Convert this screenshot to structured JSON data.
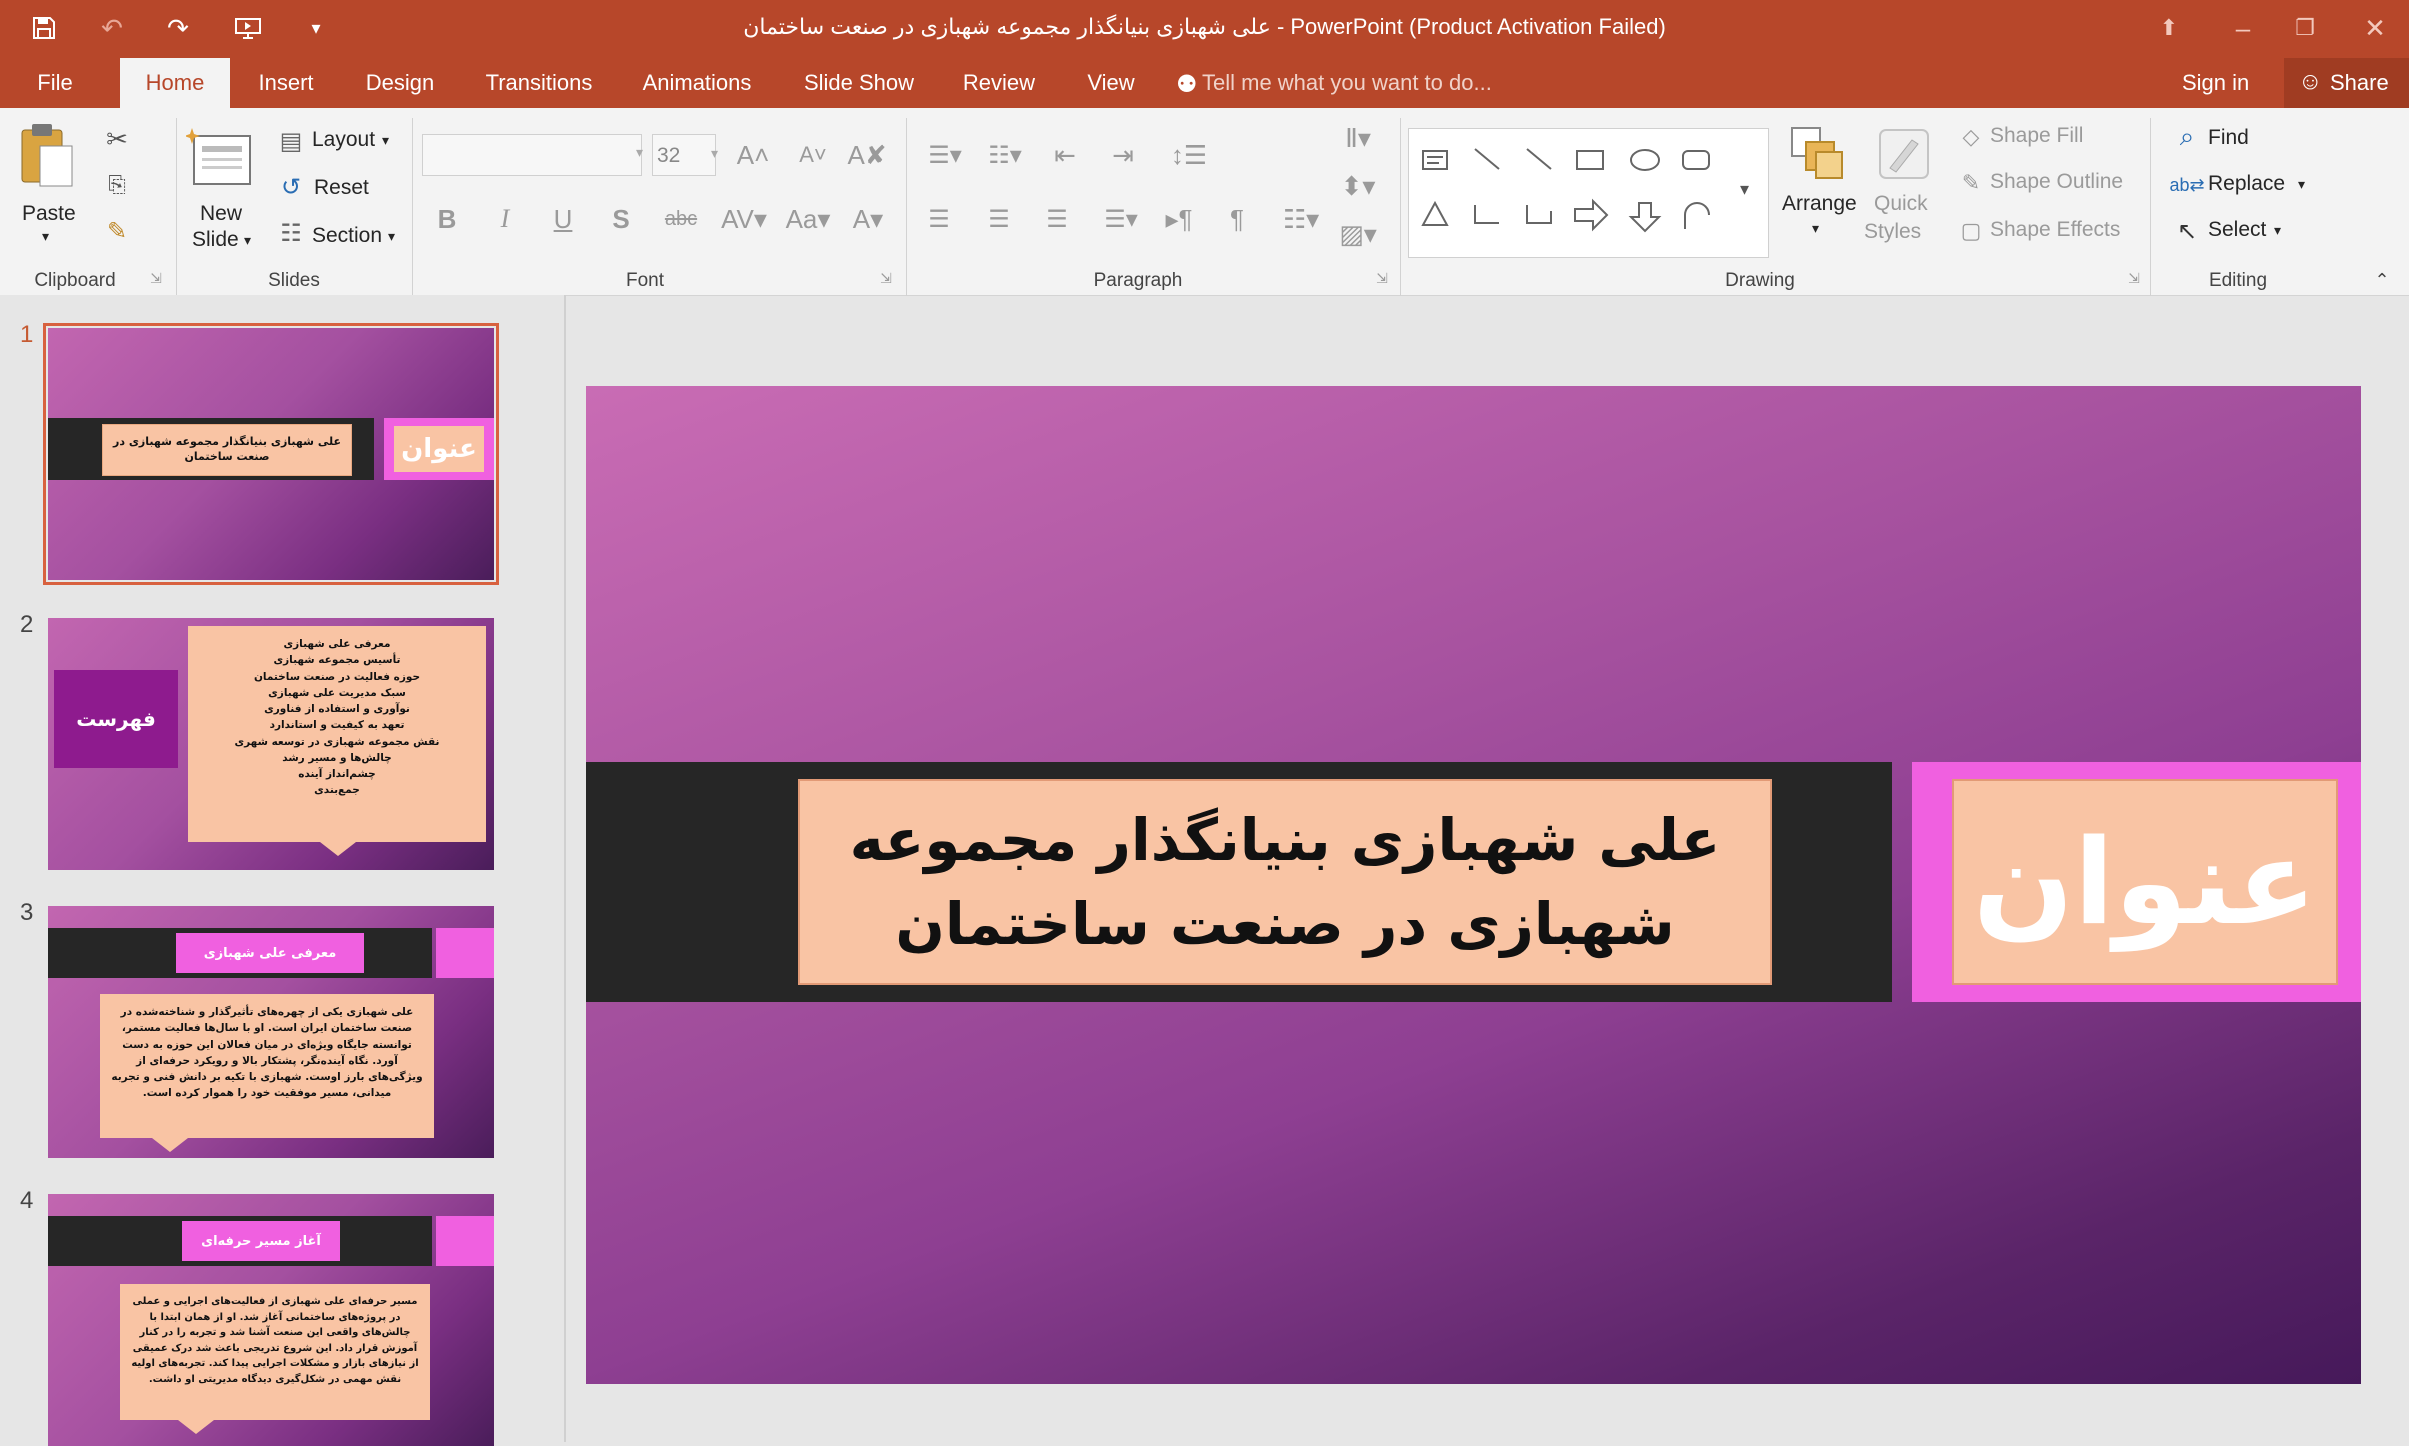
{
  "window": {
    "title": "علی شهبازی بنیانگذار مجموعه شهبازی در صنعت ساختمان - PowerPoint (Product Activation Failed)"
  },
  "tabs": [
    {
      "label": "File"
    },
    {
      "label": "Home"
    },
    {
      "label": "Insert"
    },
    {
      "label": "Design"
    },
    {
      "label": "Transitions"
    },
    {
      "label": "Animations"
    },
    {
      "label": "Slide Show"
    },
    {
      "label": "Review"
    },
    {
      "label": "View"
    }
  ],
  "tell_me": {
    "placeholder": "Tell me what you want to do..."
  },
  "account": {
    "sign_in": "Sign in",
    "share": "Share"
  },
  "ribbon": {
    "clipboard": {
      "label": "Clipboard",
      "paste": "Paste"
    },
    "slides": {
      "label": "Slides",
      "new_slide_1": "New",
      "new_slide_2": "Slide",
      "layout": "Layout",
      "reset": "Reset",
      "section": "Section"
    },
    "font": {
      "label": "Font",
      "size": "32",
      "bold": "B",
      "italic": "I",
      "underline": "U",
      "shadow": "S",
      "strike": "abc",
      "case": "Aa"
    },
    "paragraph": {
      "label": "Paragraph"
    },
    "drawing": {
      "label": "Drawing",
      "arrange": "Arrange",
      "quick_styles_1": "Quick",
      "quick_styles_2": "Styles",
      "shape_fill": "Shape Fill",
      "shape_outline": "Shape Outline",
      "shape_effects": "Shape Effects"
    },
    "editing": {
      "label": "Editing",
      "find": "Find",
      "replace": "Replace",
      "select": "Select"
    }
  },
  "thumbnails": [
    {
      "number": "1",
      "title": "علی شهبازی بنیانگذار مجموعه شهبازی در صنعت ساختمان",
      "tag": "عنوان"
    },
    {
      "number": "2",
      "tag": "فهرست",
      "items": [
        "معرفی علی شهبازی",
        "تأسیس مجموعه شهبازی",
        "حوزه فعالیت در صنعت ساختمان",
        "سبک مدیریت علی شهبازی",
        "نوآوری و استفاده از فناوری",
        "تعهد به کیفیت و استاندارد",
        "نقش مجموعه شهبازی در توسعه شهری",
        "چالش‌ها و مسیر رشد",
        "چشم‌انداز آینده",
        "جمع‌بندی"
      ]
    },
    {
      "number": "3",
      "title": "معرفی علی شهبازی",
      "body": "علی شهبازی یکی از چهره‌های تأثیرگذار و شناخته‌شده در صنعت ساختمان ایران است. او با سال‌ها فعالیت مستمر، توانسته جایگاه ویژه‌ای در میان فعالان این حوزه به دست آورد. نگاه آینده‌نگر، پشتکار بالا و رویکرد حرفه‌ای از ویژگی‌های بارز اوست. شهبازی با تکیه بر دانش فنی و تجربه میدانی، مسیر موفقیت خود را هموار کرده است."
    },
    {
      "number": "4",
      "title": "آغاز مسیر حرفه‌ای",
      "body": "مسیر حرفه‌ای علی شهبازی از فعالیت‌های اجرایی و عملی در پروژه‌های ساختمانی آغاز شد. او از همان ابتدا با چالش‌های واقعی این صنعت آشنا شد و تجربه را در کنار آموزش قرار داد. این شروع تدریجی باعث شد درک عمیقی از نیازهای بازار و مشکلات اجرایی پیدا کند. تجربه‌های اولیه نقش مهمی در شکل‌گیری دیدگاه مدیریتی او داشت."
    }
  ],
  "main_slide": {
    "title": "علی شهبازی بنیانگذار مجموعه شهبازی در صنعت ساختمان",
    "tag": "عنوان"
  },
  "colors": {
    "accent": "#b7472a",
    "title_box": "#f9c4a4",
    "tag_box": "#f060e0",
    "band": "#262626"
  }
}
